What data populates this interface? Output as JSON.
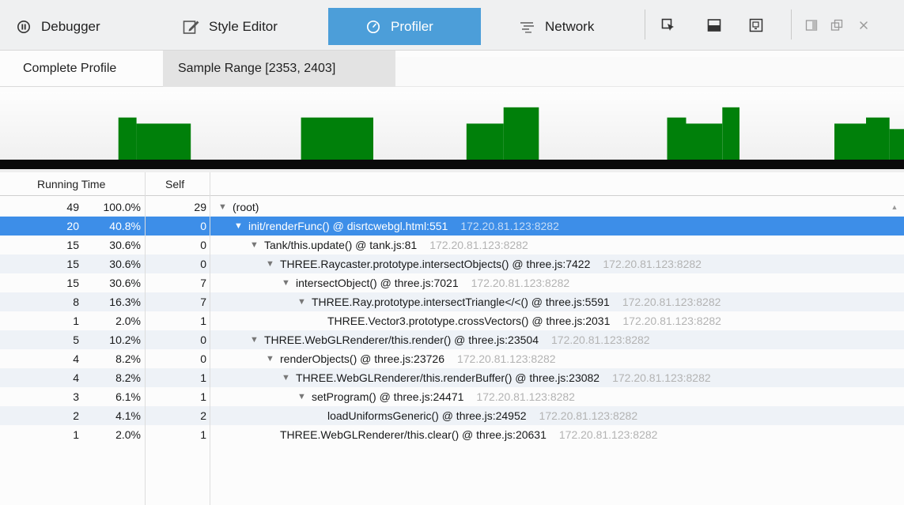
{
  "toolbar": {
    "tabs": [
      {
        "label": "Debugger",
        "icon": "pause-circle-icon"
      },
      {
        "label": "Style Editor",
        "icon": "pencil-box-icon"
      },
      {
        "label": "Profiler",
        "icon": "stopwatch-icon"
      },
      {
        "label": "Network",
        "icon": "network-lines-icon"
      }
    ],
    "active_tab": "Profiler",
    "commands": [
      "pick-element-icon",
      "split-console-icon",
      "responsive-mode-icon",
      "dock-side-icon",
      "undock-window-icon",
      "close-icon"
    ]
  },
  "subtabs": [
    {
      "label": "Complete Profile"
    },
    {
      "label": "Sample Range [2353, 2403]"
    }
  ],
  "graph": {
    "color": "#00800a",
    "bar_levels": [
      {
        "start": 0.131,
        "end": 0.151,
        "level": 0.62
      },
      {
        "start": 0.151,
        "end": 0.211,
        "level": 0.53
      },
      {
        "start": 0.333,
        "end": 0.413,
        "level": 0.62
      },
      {
        "start": 0.516,
        "end": 0.557,
        "level": 0.53
      },
      {
        "start": 0.557,
        "end": 0.596,
        "level": 0.77
      },
      {
        "start": 0.738,
        "end": 0.759,
        "level": 0.62
      },
      {
        "start": 0.759,
        "end": 0.799,
        "level": 0.53
      },
      {
        "start": 0.799,
        "end": 0.818,
        "level": 0.77
      },
      {
        "start": 0.923,
        "end": 0.958,
        "level": 0.53
      },
      {
        "start": 0.958,
        "end": 0.984,
        "level": 0.62
      },
      {
        "start": 0.984,
        "end": 1.0,
        "level": 0.45
      }
    ]
  },
  "tree": {
    "columns": {
      "running_time": "Running Time",
      "self": "Self"
    },
    "rows": [
      {
        "samples": "49",
        "percent": "100.0%",
        "self": "29",
        "name": "(root)",
        "host": "",
        "depth": 0,
        "expandable": true,
        "selected": false
      },
      {
        "samples": "20",
        "percent": "40.8%",
        "self": "0",
        "name": "init/renderFunc() @ disrtcwebgl.html:551",
        "host": "172.20.81.123:8282",
        "depth": 1,
        "expandable": true,
        "selected": true
      },
      {
        "samples": "15",
        "percent": "30.6%",
        "self": "0",
        "name": "Tank/this.update() @ tank.js:81",
        "host": "172.20.81.123:8282",
        "depth": 2,
        "expandable": true,
        "selected": false
      },
      {
        "samples": "15",
        "percent": "30.6%",
        "self": "0",
        "name": "THREE.Raycaster.prototype.intersectObjects() @ three.js:7422",
        "host": "172.20.81.123:8282",
        "depth": 3,
        "expandable": true,
        "selected": false
      },
      {
        "samples": "15",
        "percent": "30.6%",
        "self": "7",
        "name": "intersectObject() @ three.js:7021",
        "host": "172.20.81.123:8282",
        "depth": 4,
        "expandable": true,
        "selected": false
      },
      {
        "samples": "8",
        "percent": "16.3%",
        "self": "7",
        "name": "THREE.Ray.prototype.intersectTriangle</<() @ three.js:5591",
        "host": "172.20.81.123:8282",
        "depth": 5,
        "expandable": true,
        "selected": false
      },
      {
        "samples": "1",
        "percent": "2.0%",
        "self": "1",
        "name": "THREE.Vector3.prototype.crossVectors() @ three.js:2031",
        "host": "172.20.81.123:8282",
        "depth": 6,
        "expandable": false,
        "selected": false
      },
      {
        "samples": "5",
        "percent": "10.2%",
        "self": "0",
        "name": "THREE.WebGLRenderer/this.render() @ three.js:23504",
        "host": "172.20.81.123:8282",
        "depth": 2,
        "expandable": true,
        "selected": false
      },
      {
        "samples": "4",
        "percent": "8.2%",
        "self": "0",
        "name": "renderObjects() @ three.js:23726",
        "host": "172.20.81.123:8282",
        "depth": 3,
        "expandable": true,
        "selected": false
      },
      {
        "samples": "4",
        "percent": "8.2%",
        "self": "1",
        "name": "THREE.WebGLRenderer/this.renderBuffer() @ three.js:23082",
        "host": "172.20.81.123:8282",
        "depth": 4,
        "expandable": true,
        "selected": false
      },
      {
        "samples": "3",
        "percent": "6.1%",
        "self": "1",
        "name": "setProgram() @ three.js:24471",
        "host": "172.20.81.123:8282",
        "depth": 5,
        "expandable": true,
        "selected": false
      },
      {
        "samples": "2",
        "percent": "4.1%",
        "self": "2",
        "name": "loadUniformsGeneric() @ three.js:24952",
        "host": "172.20.81.123:8282",
        "depth": 6,
        "expandable": false,
        "selected": false
      },
      {
        "samples": "1",
        "percent": "2.0%",
        "self": "1",
        "name": "THREE.WebGLRenderer/this.clear() @ three.js:20631",
        "host": "172.20.81.123:8282",
        "depth": 3,
        "expandable": false,
        "selected": false
      }
    ]
  }
}
